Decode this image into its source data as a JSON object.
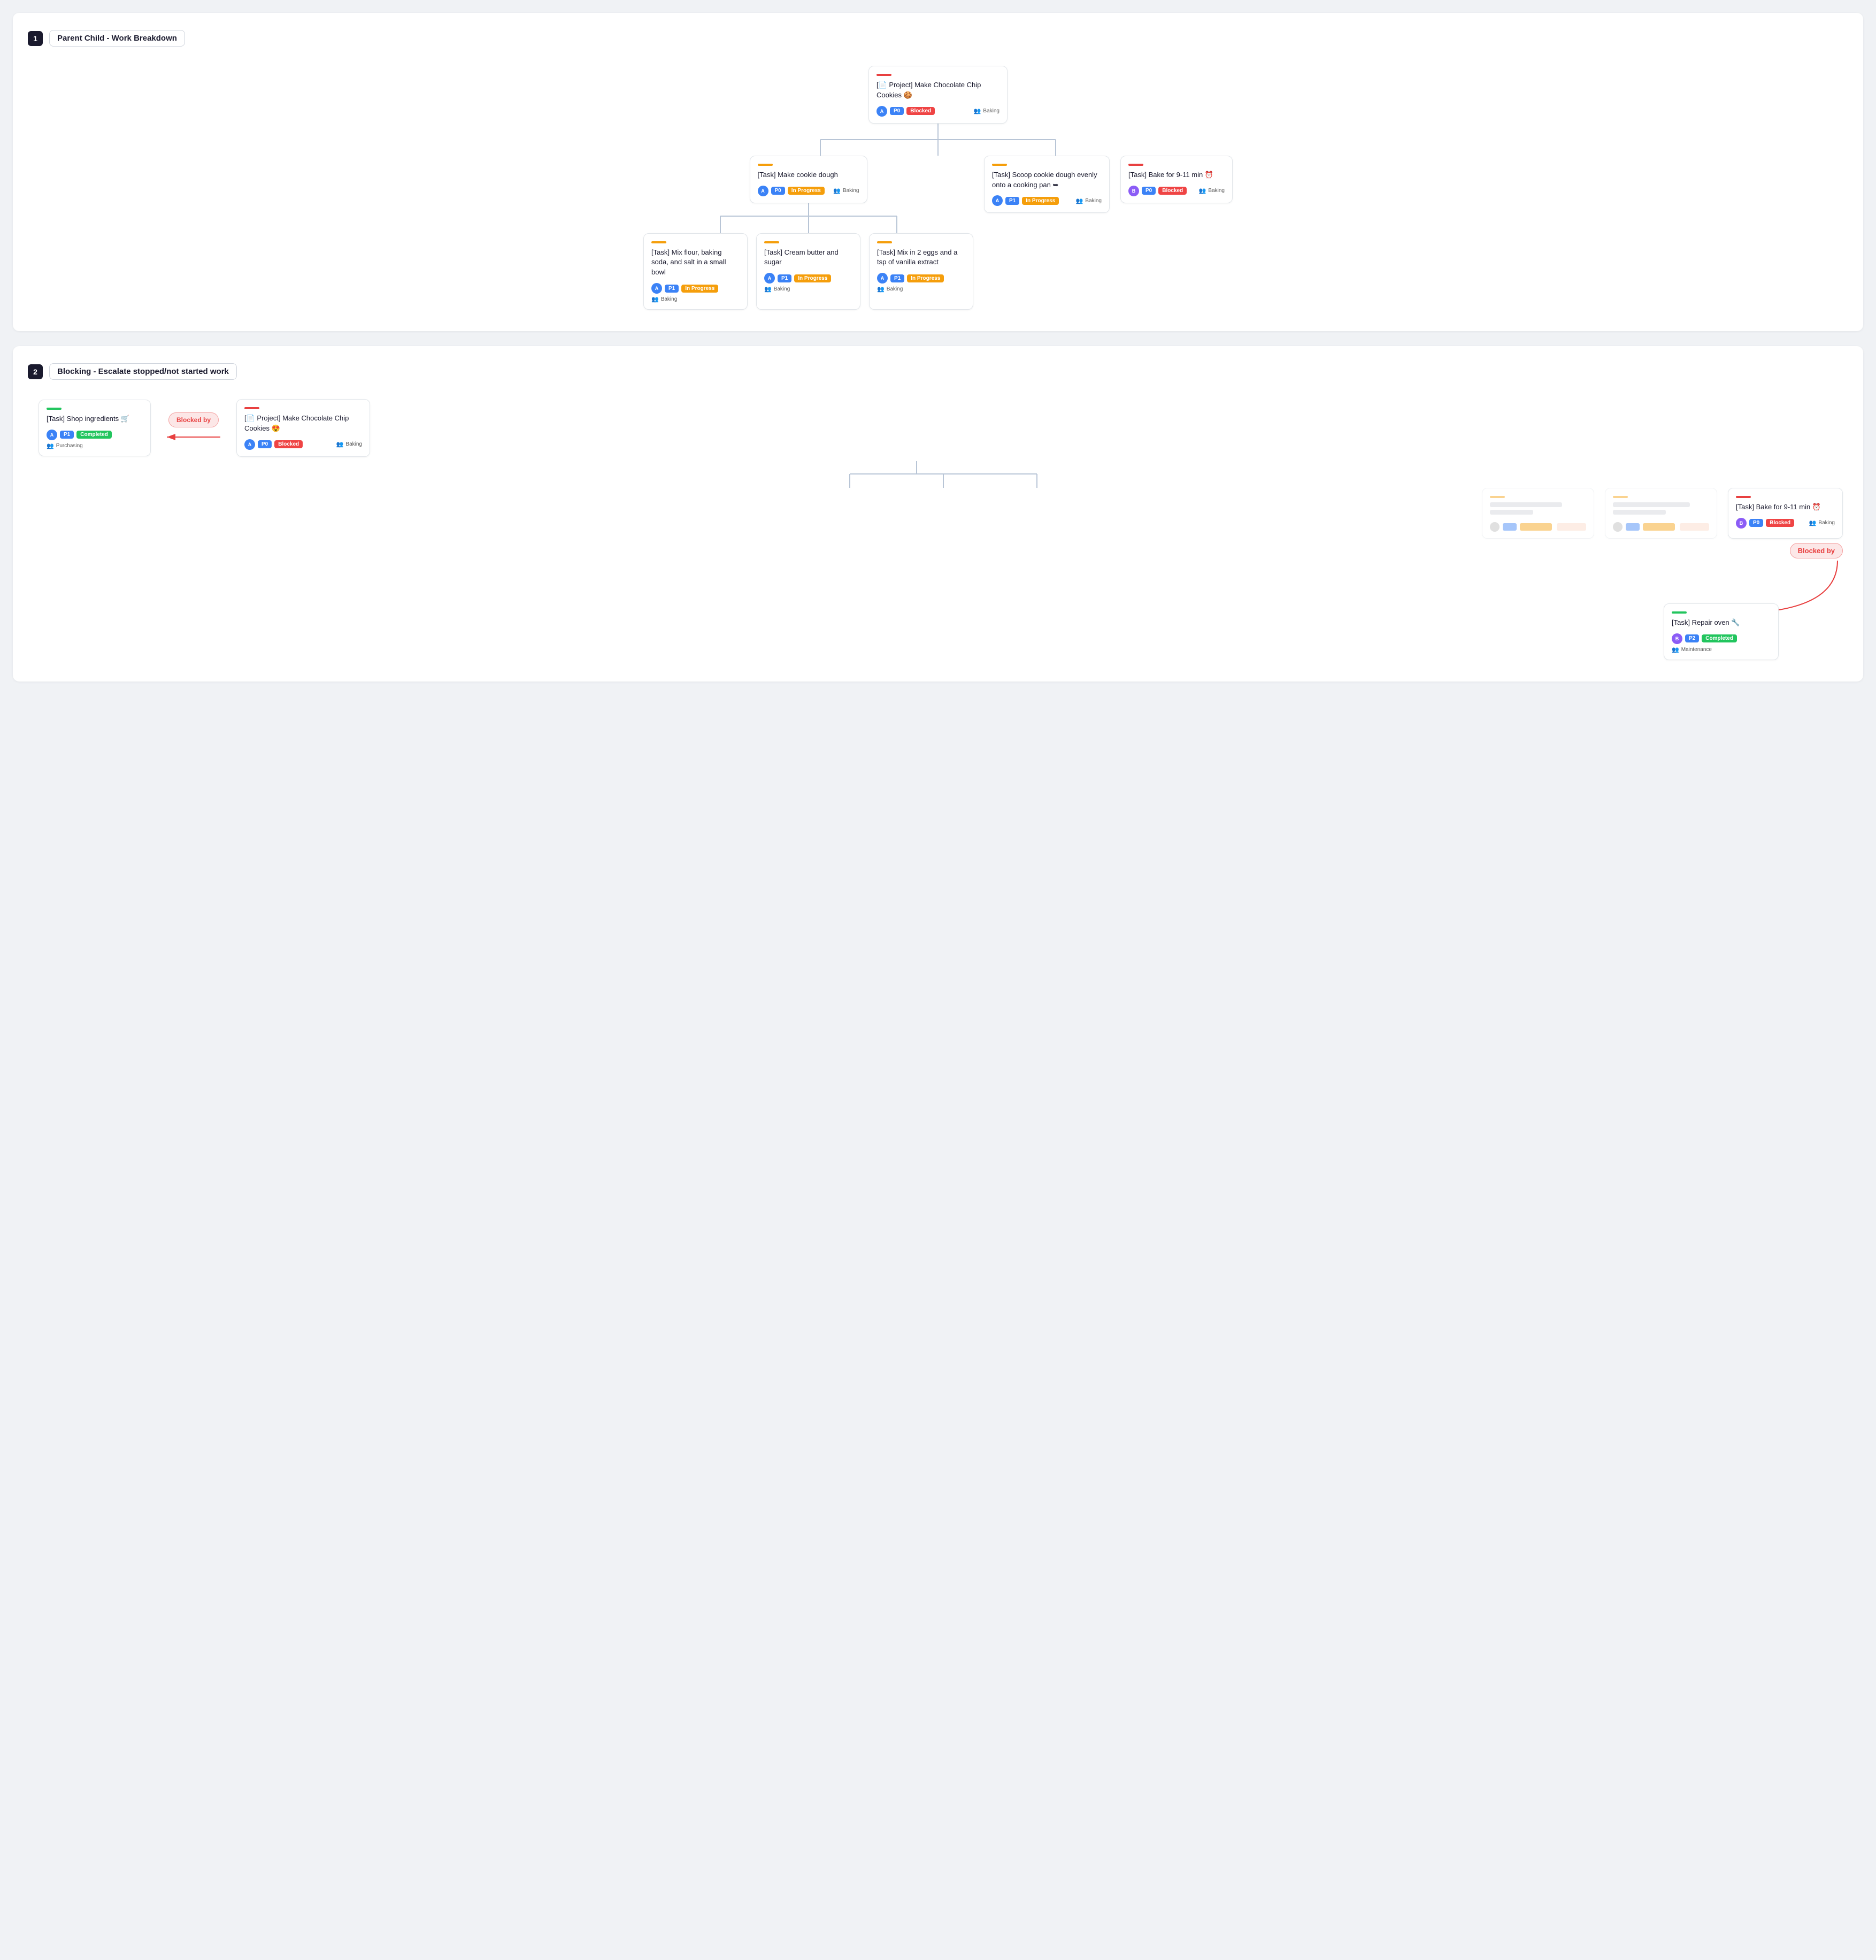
{
  "section1": {
    "number": "1",
    "title": "Parent Child - Work Breakdown",
    "root": {
      "accent": "accent-red",
      "title": "[📄 Project] Make Chocolate Chip Cookies 🍪",
      "avatar_color": "avatar-blue",
      "avatar_text": "A",
      "priority": "P0",
      "priority_class": "badge-p0",
      "status": "Blocked",
      "status_class": "badge-blocked",
      "team": "Baking"
    },
    "level2": [
      {
        "accent": "accent-orange",
        "title": "[Task] Make cookie dough",
        "avatar_color": "avatar-blue",
        "avatar_text": "A",
        "priority": "P0",
        "priority_class": "badge-p0",
        "status": "In Progress",
        "status_class": "badge-in-progress",
        "team": "Baking"
      },
      {
        "accent": "accent-orange",
        "title": "[Task] Scoop cookie dough evenly onto a cooking pan ➥",
        "avatar_color": "avatar-blue",
        "avatar_text": "A",
        "priority": "P1",
        "priority_class": "badge-p1",
        "status": "In Progress",
        "status_class": "badge-in-progress",
        "team": "Baking"
      },
      {
        "accent": "accent-red",
        "title": "[Task] Bake for 9-11 min ⏰",
        "avatar_color": "avatar-purple",
        "avatar_text": "B",
        "priority": "P0",
        "priority_class": "badge-p0",
        "status": "Blocked",
        "status_class": "badge-blocked",
        "team": "Baking"
      }
    ],
    "level3": [
      {
        "accent": "accent-orange",
        "title": "[Task] Mix flour, baking soda, and salt in a small bowl",
        "avatar_color": "avatar-blue",
        "avatar_text": "A",
        "priority": "P1",
        "priority_class": "badge-p1",
        "status": "In Progress",
        "status_class": "badge-in-progress",
        "team": "Baking"
      },
      {
        "accent": "accent-orange",
        "title": "[Task] Cream butter and sugar",
        "avatar_color": "avatar-blue",
        "avatar_text": "A",
        "priority": "P1",
        "priority_class": "badge-p1",
        "status": "In Progress",
        "status_class": "badge-in-progress",
        "team": "Baking"
      },
      {
        "accent": "accent-orange",
        "title": "[Task] Mix in 2 eggs and a tsp of vanilla extract",
        "avatar_color": "avatar-blue",
        "avatar_text": "A",
        "priority": "P1",
        "priority_class": "badge-p1",
        "status": "In Progress",
        "status_class": "badge-in-progress",
        "team": "Baking"
      }
    ]
  },
  "section2": {
    "number": "2",
    "title": "Blocking - Escalate stopped/not started work",
    "blocker": {
      "accent": "accent-green",
      "title": "[Task] Shop ingredients 🛒",
      "avatar_color": "avatar-blue",
      "avatar_text": "A",
      "priority": "P1",
      "priority_class": "badge-p1",
      "status": "Completed",
      "status_class": "badge-completed",
      "team": "Purchasing"
    },
    "blocked_by_label_1": "Blocked by",
    "root": {
      "accent": "accent-red",
      "title": "[📄 Project] Make Chocolate Chip Cookies 😍",
      "avatar_color": "avatar-blue",
      "avatar_text": "A",
      "priority": "P0",
      "priority_class": "badge-p0",
      "status": "Blocked",
      "status_class": "badge-blocked",
      "team": "Baking"
    },
    "level2_blurred": [
      {
        "accent": "accent-orange"
      },
      {
        "accent": "accent-orange"
      }
    ],
    "bake_task": {
      "accent": "accent-red",
      "title": "[Task] Bake for 9-11 min ⏰",
      "avatar_color": "avatar-purple",
      "avatar_text": "B",
      "priority": "P0",
      "priority_class": "badge-p0",
      "status": "Blocked",
      "status_class": "badge-blocked",
      "team": "Baking"
    },
    "blocked_by_label_2": "Blocked by",
    "repair_task": {
      "accent": "accent-green",
      "title": "[Task] Repair oven 🔧",
      "avatar_color": "avatar-purple",
      "avatar_text": "B",
      "priority": "P2",
      "priority_class": "badge-p2",
      "status": "Completed",
      "status_class": "badge-completed",
      "team": "Maintenance"
    }
  }
}
